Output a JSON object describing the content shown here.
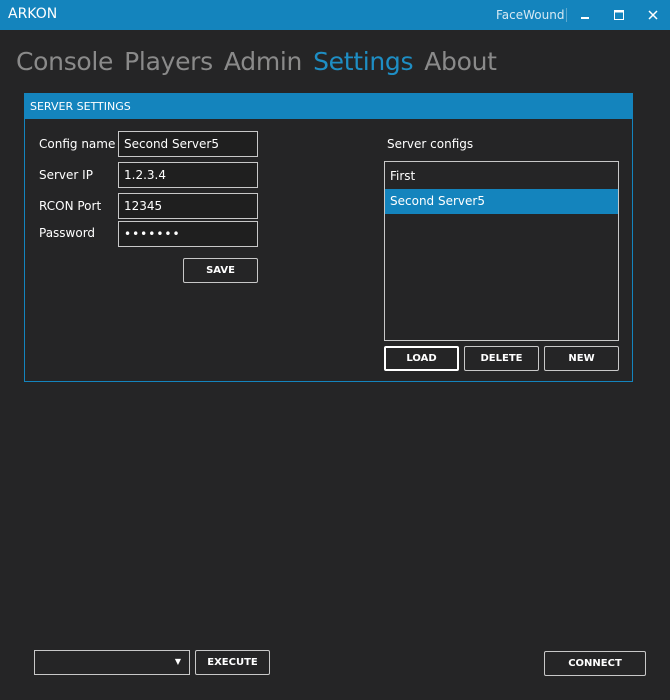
{
  "window": {
    "app_title": "ARKON",
    "user": "FaceWound",
    "minimize_icon": "minimize-icon",
    "maximize_icon": "maximize-icon",
    "close_icon": "close-icon"
  },
  "tabs": [
    {
      "label": "Console",
      "active": false
    },
    {
      "label": "Players",
      "active": false
    },
    {
      "label": "Admin",
      "active": false
    },
    {
      "label": "Settings",
      "active": true
    },
    {
      "label": "About",
      "active": false
    }
  ],
  "server_settings": {
    "title": "SERVER SETTINGS",
    "config_name_label": "Config name",
    "config_name_value": "Second Server5",
    "server_ip_label": "Server IP",
    "server_ip_value": "1.2.3.4",
    "rcon_port_label": "RCON Port",
    "rcon_port_value": "12345",
    "password_label": "Password",
    "password_value": "1234567",
    "save_label": "SAVE",
    "configs_label": "Server configs",
    "configs": [
      {
        "name": "First",
        "selected": false
      },
      {
        "name": "Second Server5",
        "selected": true
      }
    ],
    "load_label": "LOAD",
    "delete_label": "DELETE",
    "new_label": "NEW"
  },
  "bottom": {
    "command_value": "",
    "execute_label": "EXECUTE",
    "connect_label": "CONNECT"
  },
  "colors": {
    "accent": "#1484bd",
    "background": "#252526",
    "tab_inactive": "#8a8a8a",
    "tab_active": "#1e8ec4"
  }
}
